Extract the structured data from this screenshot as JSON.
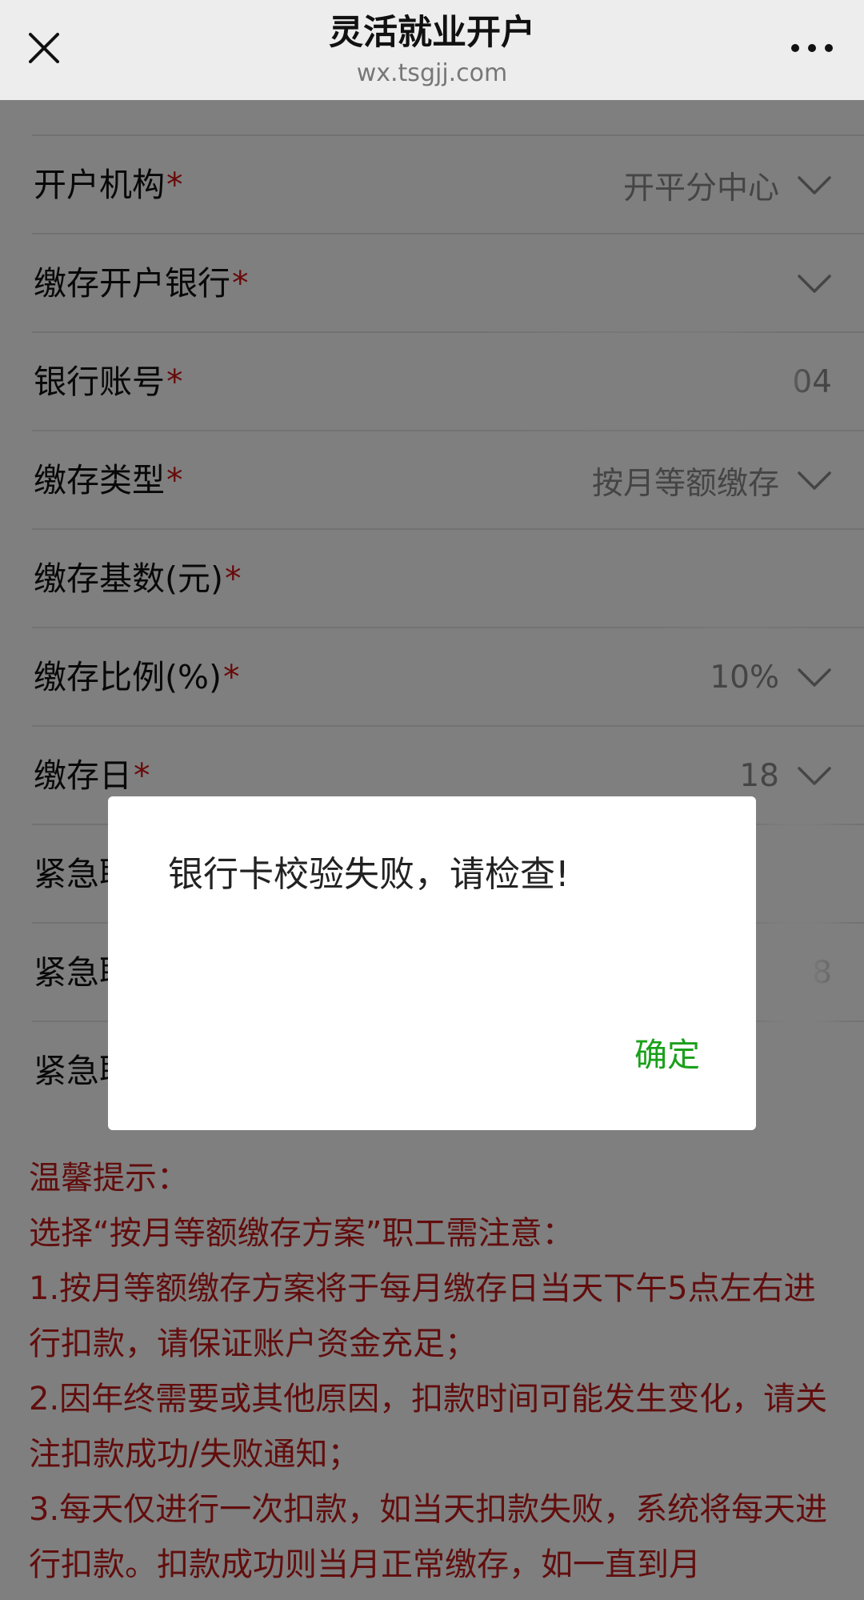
{
  "header": {
    "title": "灵活就业开户",
    "domain": "wx.tsgjj.com"
  },
  "form": {
    "rows": [
      {
        "label": "开户机构",
        "value": "开平分中心"
      },
      {
        "label": "缴存开户银行",
        "value": ""
      },
      {
        "label": "银行账号",
        "value": "04"
      },
      {
        "label": "缴存类型",
        "value": "按月等额缴存"
      },
      {
        "label": "缴存基数(元)",
        "value": ""
      },
      {
        "label": "缴存比例(%)",
        "value": "10%"
      },
      {
        "label": "缴存日",
        "value": "18"
      },
      {
        "label": "紧急联",
        "value": ""
      },
      {
        "label": "紧急联",
        "value": "8"
      },
      {
        "label": "紧急联",
        "value": ""
      }
    ],
    "required_mark": "*"
  },
  "tips": {
    "title": "温馨提示：",
    "lines": [
      "选择“按月等额缴存方案”职工需注意：",
      "1.按月等额缴存方案将于每月缴存日当天下午5点左右进行扣款，请保证账户资金充足；",
      "2.因年终需要或其他原因，扣款时间可能发生变化，请关注扣款成功/失败通知；",
      "3.每天仅进行一次扣款，如当天扣款失败，系统将每天进行扣款。扣款成功则当月正常缴存，如一直到月"
    ]
  },
  "dialog": {
    "message": "银行卡校验失败，请检查!",
    "confirm_label": "确定"
  },
  "colors": {
    "required": "#d21414",
    "tips": "#c51a1a",
    "confirm": "#1aa01a"
  },
  "icons": {
    "close": "close-icon",
    "more": "more-icon",
    "chevron": "chevron-down-icon"
  }
}
